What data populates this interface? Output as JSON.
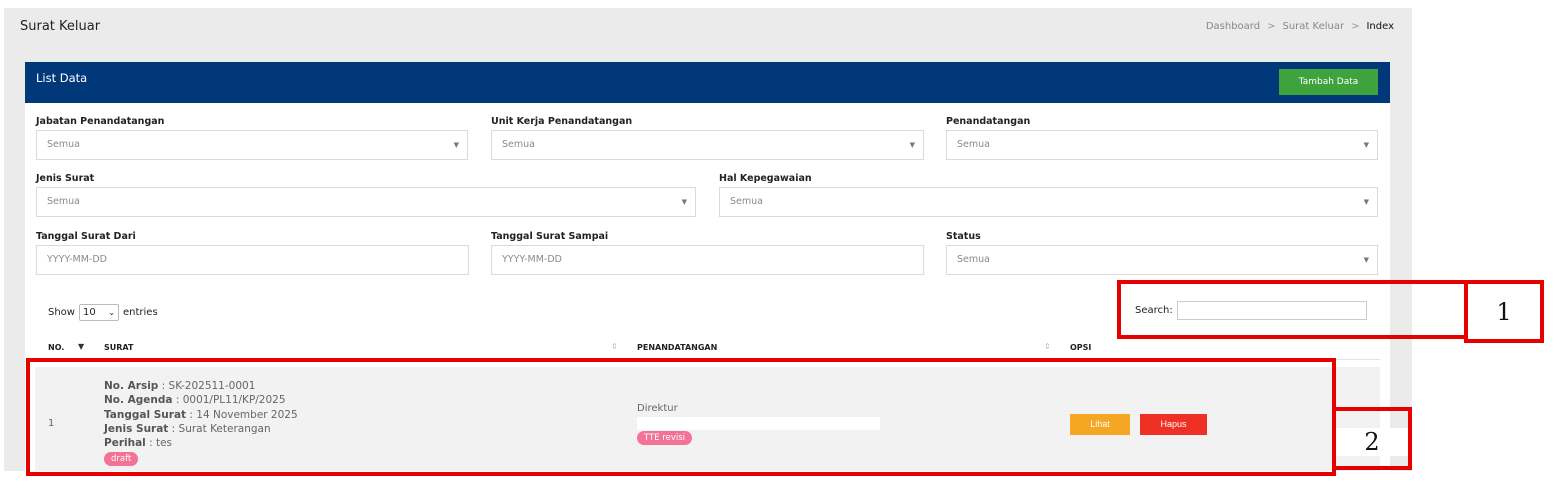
{
  "page": {
    "title": "Surat Keluar",
    "breadcrumb": [
      "Dashboard",
      "Surat Keluar",
      "Index"
    ],
    "breadcrumb_separator": ">"
  },
  "card": {
    "title": "List Data",
    "add_button": "Tambah Data"
  },
  "filters": {
    "jabatan": {
      "label": "Jabatan Penandatangan",
      "value": "Semua"
    },
    "unit_kerja": {
      "label": "Unit Kerja Penandatangan",
      "value": "Semua"
    },
    "penandatangan": {
      "label": "Penandatangan",
      "value": "Semua"
    },
    "jenis_surat": {
      "label": "Jenis Surat",
      "value": "Semua"
    },
    "hal_kepegawaian": {
      "label": "Hal Kepegawaian",
      "value": "Semua"
    },
    "tanggal_dari": {
      "label": "Tanggal Surat Dari",
      "placeholder": "YYYY-MM-DD"
    },
    "tanggal_sampai": {
      "label": "Tanggal Surat Sampai",
      "placeholder": "YYYY-MM-DD"
    },
    "status": {
      "label": "Status",
      "value": "Semua"
    }
  },
  "table_controls": {
    "show_label": "Show",
    "entries_value": "10",
    "entries_label": "entries",
    "search_label": "Search:"
  },
  "table": {
    "headers": [
      "NO.",
      "SURAT",
      "PENANDATANGAN",
      "OPSI"
    ],
    "rows": [
      {
        "no": "1",
        "no_arsip_label": "No. Arsip",
        "no_arsip": " : SK-202511-0001",
        "no_agenda_label": "No. Agenda",
        "no_agenda": " : 0001/PL11/KP/2025",
        "tanggal_label": "Tanggal Surat",
        "tanggal": " : 14 November 2025",
        "jenis_label": "Jenis Surat",
        "jenis": " : Surat Keterangan",
        "perihal_label": "Perihal",
        "perihal": " : tes",
        "status_badge": "draft",
        "signer": "Direktur",
        "signer_badge": "TTE revisi",
        "view_button": "Lihat",
        "delete_button": "Hapus"
      }
    ]
  },
  "annotations": {
    "callout_1": "1",
    "callout_2": "2"
  }
}
